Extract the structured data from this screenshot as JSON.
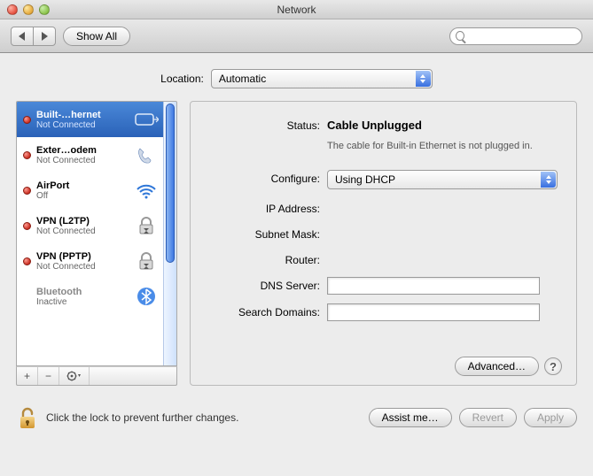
{
  "window": {
    "title": "Network"
  },
  "toolbar": {
    "back_aria": "Back",
    "forward_aria": "Forward",
    "show_all": "Show All",
    "search_placeholder": ""
  },
  "location": {
    "label": "Location:",
    "value": "Automatic"
  },
  "sidebar": {
    "items": [
      {
        "name": "Built-…hernet",
        "status": "Not Connected",
        "dot": "red",
        "icon": "ethernet",
        "selected": true
      },
      {
        "name": "Exter…odem",
        "status": "Not Connected",
        "dot": "red",
        "icon": "phone",
        "selected": false
      },
      {
        "name": "AirPort",
        "status": "Off",
        "dot": "red",
        "icon": "wifi",
        "selected": false
      },
      {
        "name": "VPN (L2TP)",
        "status": "Not Connected",
        "dot": "red",
        "icon": "padlock",
        "selected": false
      },
      {
        "name": "VPN (PPTP)",
        "status": "Not Connected",
        "dot": "red",
        "icon": "padlock",
        "selected": false
      },
      {
        "name": "Bluetooth",
        "status": "Inactive",
        "dot": "gray",
        "icon": "bluetooth",
        "selected": false
      }
    ],
    "footer": {
      "add": "+",
      "remove": "−",
      "action": "✻▾"
    }
  },
  "details": {
    "status_label": "Status:",
    "status_value": "Cable Unplugged",
    "status_description": "The cable for Built-in Ethernet is not plugged in.",
    "configure_label": "Configure:",
    "configure_value": "Using DHCP",
    "ip_label": "IP Address:",
    "subnet_label": "Subnet Mask:",
    "router_label": "Router:",
    "dns_label": "DNS Server:",
    "search_domains_label": "Search Domains:",
    "advanced": "Advanced…",
    "help": "?"
  },
  "bottom": {
    "lock_text": "Click the lock to prevent further changes.",
    "assist": "Assist me…",
    "revert": "Revert",
    "apply": "Apply"
  }
}
